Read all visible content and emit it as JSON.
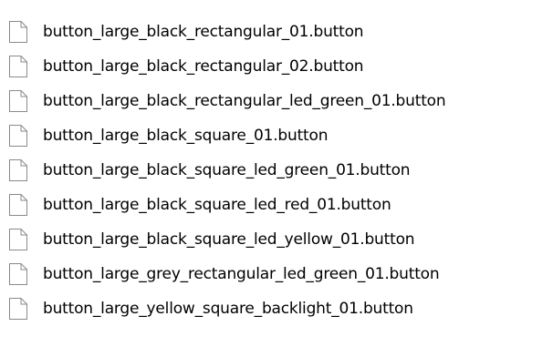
{
  "files": [
    {
      "name": "button_large_black_rectangular_01.button",
      "icon": "blank-file-icon"
    },
    {
      "name": "button_large_black_rectangular_02.button",
      "icon": "blank-file-icon"
    },
    {
      "name": "button_large_black_rectangular_led_green_01.button",
      "icon": "blank-file-icon"
    },
    {
      "name": "button_large_black_square_01.button",
      "icon": "blank-file-icon"
    },
    {
      "name": "button_large_black_square_led_green_01.button",
      "icon": "blank-file-icon"
    },
    {
      "name": "button_large_black_square_led_red_01.button",
      "icon": "blank-file-icon"
    },
    {
      "name": "button_large_black_square_led_yellow_01.button",
      "icon": "blank-file-icon"
    },
    {
      "name": "button_large_grey_rectangular_led_green_01.button",
      "icon": "blank-file-icon"
    },
    {
      "name": "button_large_yellow_square_backlight_01.button",
      "icon": "blank-file-icon"
    }
  ]
}
